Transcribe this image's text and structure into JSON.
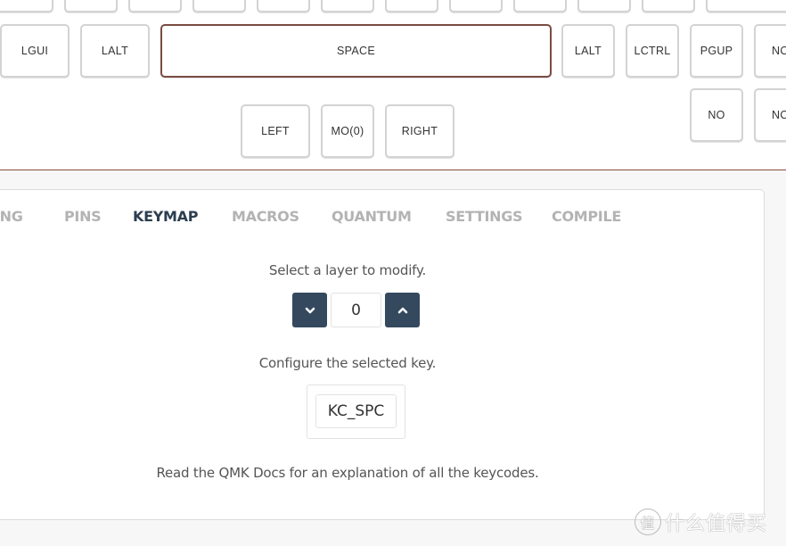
{
  "keyboard": {
    "top_row_keys": [
      "",
      "",
      "",
      "",
      "",
      "",
      "",
      "",
      "",
      "",
      "",
      ""
    ],
    "bottom_row_keys": [
      {
        "label": "LGUI"
      },
      {
        "label": "LALT"
      },
      {
        "label": "SPACE",
        "selected": true
      },
      {
        "label": "LALT"
      },
      {
        "label": "LCTRL"
      },
      {
        "label": "PGUP"
      },
      {
        "label": "NO"
      }
    ],
    "arrow_row_keys": [
      {
        "label": "LEFT"
      },
      {
        "label": "MO(0)"
      },
      {
        "label": "RIGHT"
      },
      {
        "label": "NO"
      },
      {
        "label": "NO"
      }
    ],
    "selected_border_color": "#7a4b42",
    "divider_color": "#8a4b3f"
  },
  "tabs": [
    {
      "label": "WIRING",
      "active": false
    },
    {
      "label": "PINS",
      "active": false
    },
    {
      "label": "KEYMAP",
      "active": true
    },
    {
      "label": "MACROS",
      "active": false
    },
    {
      "label": "QUANTUM",
      "active": false
    },
    {
      "label": "SETTINGS",
      "active": false
    },
    {
      "label": "COMPILE",
      "active": false
    }
  ],
  "keymap": {
    "layer_prompt": "Select a layer to modify.",
    "layer_value": "0",
    "layer_down_icon": "chevron-down-icon",
    "layer_up_icon": "chevron-up-icon",
    "key_prompt": "Configure the selected key.",
    "key_code": "KC_SPC",
    "docs_note": "Read the QMK Docs for an explanation of all the keycodes.",
    "accent_color": "#34495e"
  },
  "watermark": {
    "badge": "值",
    "text": "什么值得买"
  }
}
